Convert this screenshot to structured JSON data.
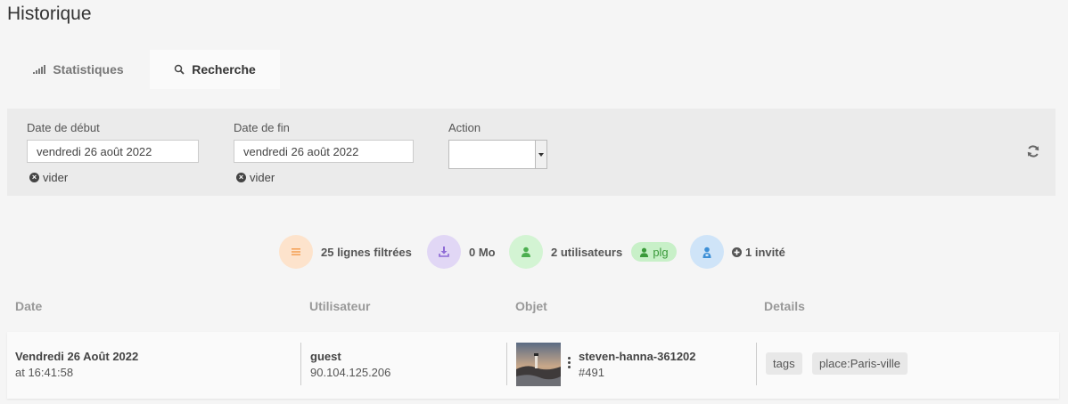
{
  "page": {
    "title": "Historique"
  },
  "tabs": [
    {
      "label": "Statistiques",
      "icon": "signal-bars-icon"
    },
    {
      "label": "Recherche",
      "icon": "search-icon",
      "active": true
    }
  ],
  "filters": {
    "start": {
      "label": "Date de début",
      "value": "vendredi 26 août 2022",
      "clear_label": "vider"
    },
    "end": {
      "label": "Date de fin",
      "value": "vendredi 26 août 2022",
      "clear_label": "vider"
    },
    "action": {
      "label": "Action",
      "value": ""
    },
    "refresh_icon": "refresh-icon"
  },
  "summary": {
    "lines": {
      "text": "25 lignes filtrées",
      "icon": "list-icon",
      "color": "#f5a35a"
    },
    "size": {
      "text": "0 Mo",
      "icon": "download-icon",
      "color": "#8e6ad6"
    },
    "users": {
      "text": "2 utilisateurs",
      "icon": "user-icon",
      "color": "#4caf50"
    },
    "user_pill": {
      "text": "plg",
      "icon": "user-icon"
    },
    "guests": {
      "text": "1 invité",
      "icon": "guest-icon",
      "color": "#3d8fd6",
      "plus_icon": "plus-circle-icon"
    }
  },
  "table": {
    "headers": [
      "Date",
      "Utilisateur",
      "Objet",
      "Details"
    ],
    "rows": [
      {
        "date": "Vendredi 26 Août 2022",
        "time": "at 16:41:58",
        "user": "guest",
        "ip": "90.104.125.206",
        "object_name": "steven-hanna-361202",
        "object_id": "#491",
        "details": [
          "tags",
          "place:Paris-ville"
        ]
      }
    ]
  },
  "colors": {
    "lines_bg": "#fde3cc",
    "size_bg": "#e1d7f5",
    "users_bg": "#d3f4d3",
    "guests_bg": "#cfe4f8"
  }
}
